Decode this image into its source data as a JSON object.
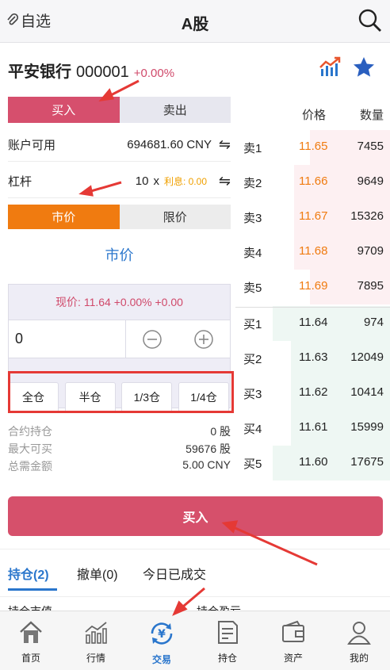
{
  "header": {
    "back_label": "自选",
    "title": "A股"
  },
  "stock": {
    "name": "平安银行",
    "code": "000001",
    "change": "+0.00%"
  },
  "trade_side": {
    "buy_label": "买入",
    "sell_label": "卖出"
  },
  "account": {
    "label": "账户可用",
    "value": "694681.60 CNY"
  },
  "leverage": {
    "label": "杠杆",
    "value": "10",
    "unit": "x",
    "interest_label": "利息: 0.00"
  },
  "order_type": {
    "market_label": "市价",
    "limit_label": "限价",
    "mode_text": "市价"
  },
  "price_panel": {
    "current": "现价: 11.64 +0.00% +0.00",
    "qty_value": "0"
  },
  "ratios": [
    "全仓",
    "半仓",
    "1/3仓",
    "1/4仓"
  ],
  "stats": [
    {
      "label": "合约持仓",
      "value": "0 股"
    },
    {
      "label": "最大可买",
      "value": "59676 股"
    },
    {
      "label": "总需金额",
      "value": "5.00 CNY"
    }
  ],
  "order_book": {
    "price_header": "价格",
    "qty_header": "数量",
    "asks": [
      {
        "name": "卖1",
        "price": "11.65",
        "qty": "7455",
        "depth": 0.52
      },
      {
        "name": "卖2",
        "price": "11.66",
        "qty": "9649",
        "depth": 0.62
      },
      {
        "name": "卖3",
        "price": "11.67",
        "qty": "15326",
        "depth": 0.62
      },
      {
        "name": "卖4",
        "price": "11.68",
        "qty": "9709",
        "depth": 0.62
      },
      {
        "name": "卖5",
        "price": "11.69",
        "qty": "7895",
        "depth": 0.52
      }
    ],
    "bids": [
      {
        "name": "买1",
        "price": "11.64",
        "qty": "974",
        "depth": 0.76
      },
      {
        "name": "买2",
        "price": "11.63",
        "qty": "12049",
        "depth": 0.64
      },
      {
        "name": "买3",
        "price": "11.62",
        "qty": "10414",
        "depth": 0.64
      },
      {
        "name": "买4",
        "price": "11.61",
        "qty": "15999",
        "depth": 0.64
      },
      {
        "name": "买5",
        "price": "11.60",
        "qty": "17675",
        "depth": 0.76
      }
    ],
    "ask_color": "#f07b10",
    "bid_color": "#222222"
  },
  "buy_button_label": "买入",
  "tabs": [
    {
      "label": "持仓(2)",
      "active": true
    },
    {
      "label": "撤单(0)",
      "active": false
    },
    {
      "label": "今日已成交",
      "active": false
    }
  ],
  "summary": {
    "left": "持仓市值",
    "right": "持仓盈亏"
  },
  "nav": [
    {
      "label": "首页",
      "icon": "home-icon"
    },
    {
      "label": "行情",
      "icon": "market-chart-icon"
    },
    {
      "label": "交易",
      "icon": "trade-yen-icon",
      "active": true
    },
    {
      "label": "持仓",
      "icon": "position-doc-icon"
    },
    {
      "label": "资产",
      "icon": "wallet-icon"
    },
    {
      "label": "我的",
      "icon": "user-icon"
    }
  ],
  "colors": {
    "buy": "#d64f6d",
    "market": "#f07b10",
    "accent": "#2a76cc",
    "alert": "#e53935"
  }
}
